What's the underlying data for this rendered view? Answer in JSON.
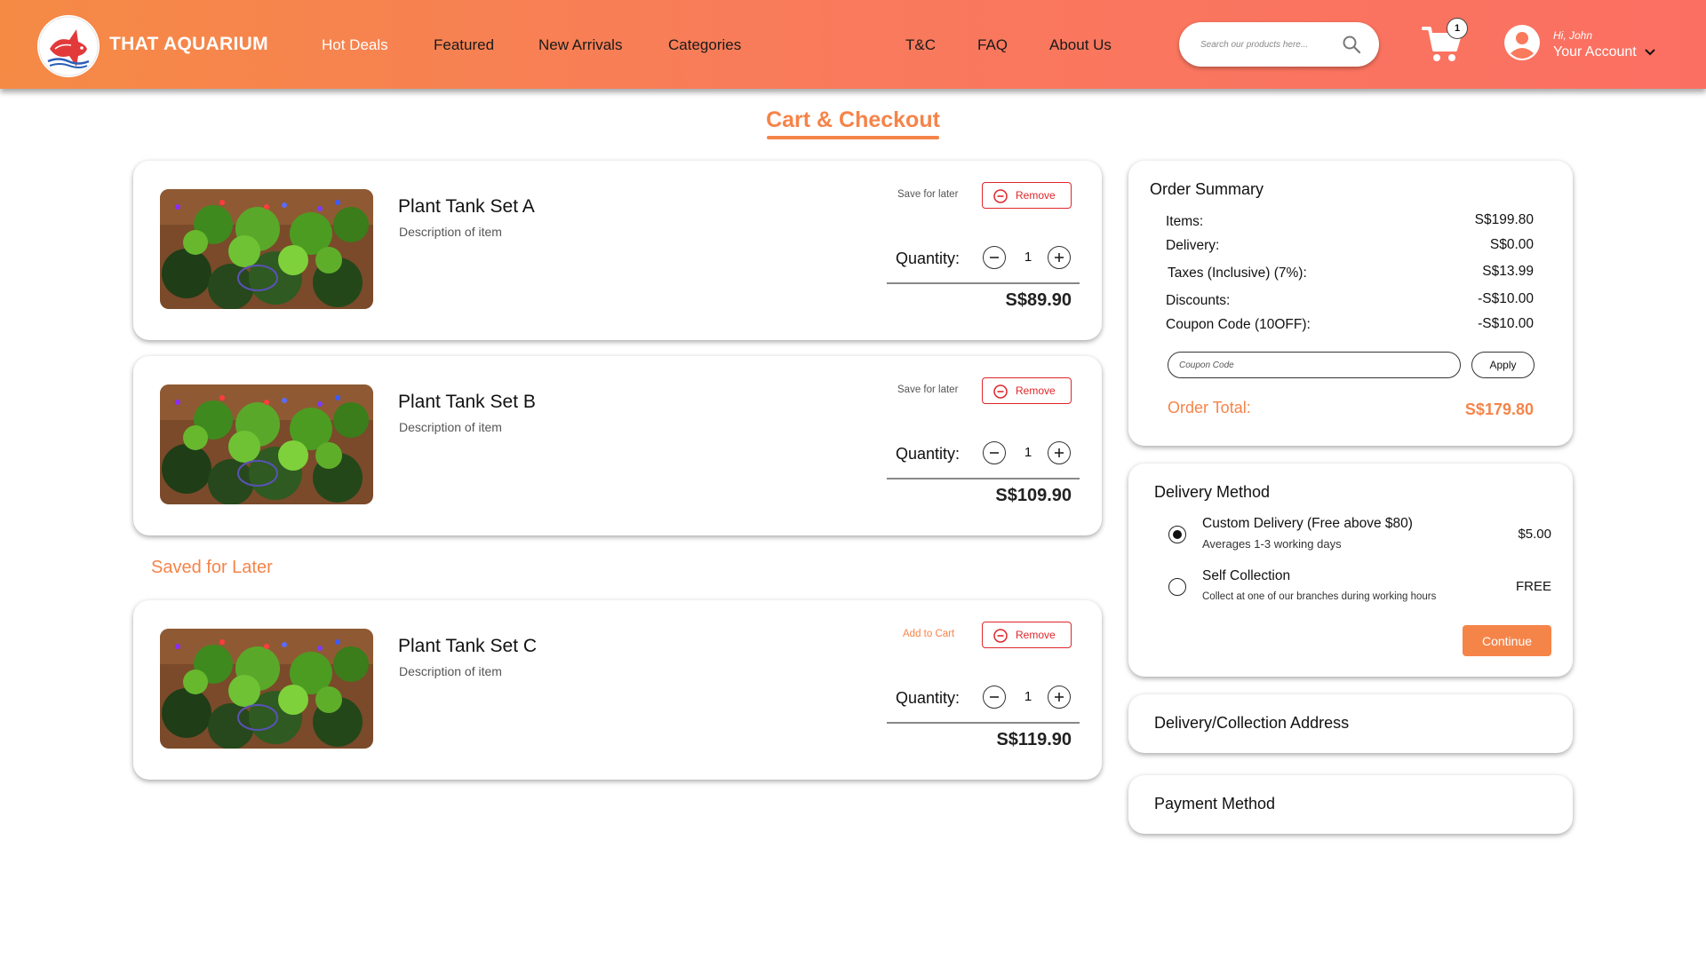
{
  "header": {
    "brand": "THAT AQUARIUM",
    "nav_left": [
      "Hot Deals",
      "Featured",
      "New Arrivals",
      "Categories"
    ],
    "nav_right": [
      "T&C",
      "FAQ",
      "About Us"
    ],
    "active_nav": "Hot Deals",
    "search_placeholder": "Search our products here...",
    "cart_count": "1",
    "greeting": "Hi, John",
    "account_label": "Your Account"
  },
  "page": {
    "title": "Cart & Checkout"
  },
  "cart_items": [
    {
      "name": "Plant Tank Set A",
      "description": "Description of item",
      "action_label": "Save for later",
      "remove_label": "Remove",
      "quantity_label": "Quantity:",
      "quantity": "1",
      "price": "S$89.90"
    },
    {
      "name": "Plant Tank Set B",
      "description": "Description of item",
      "action_label": "Save for later",
      "remove_label": "Remove",
      "quantity_label": "Quantity:",
      "quantity": "1",
      "price": "S$109.90"
    }
  ],
  "saved_for_later": {
    "heading": "Saved for Later",
    "items": [
      {
        "name": "Plant Tank Set C",
        "description": "Description of item",
        "action_label": "Add to Cart",
        "remove_label": "Remove",
        "quantity_label": "Quantity:",
        "quantity": "1",
        "price": "S$119.90"
      }
    ]
  },
  "order_summary": {
    "title": "Order Summary",
    "lines": [
      {
        "label": "Items:",
        "value": "S$199.80"
      },
      {
        "label": "Delivery:",
        "value": "S$0.00"
      },
      {
        "label": "Taxes (Inclusive) (7%):",
        "value": "S$13.99"
      },
      {
        "label": "Discounts:",
        "value": "-S$10.00"
      },
      {
        "label": "Coupon Code (10OFF):",
        "value": "-S$10.00"
      }
    ],
    "coupon_placeholder": "Coupon Code",
    "apply_label": "Apply",
    "total_label": "Order Total:",
    "total_value": "S$179.80"
  },
  "delivery_method": {
    "title": "Delivery Method",
    "options": [
      {
        "name": "Custom Delivery (Free above $80)",
        "sub": "Averages 1-3 working days",
        "price": "$5.00",
        "selected": true
      },
      {
        "name": "Self Collection",
        "sub": "Collect at one of our branches during working hours",
        "price": "FREE",
        "selected": false
      }
    ],
    "continue_label": "Continue"
  },
  "sections": {
    "address_title": "Delivery/Collection Address",
    "payment_title": "Payment Method"
  },
  "colors": {
    "accent": "#f58449",
    "remove": "#e0262a",
    "header_start": "#f58a45",
    "header_end": "#fb6f62"
  },
  "icons": [
    "logo-fish",
    "search-icon",
    "cart-icon",
    "account-icon",
    "chevron-down-icon",
    "minus-circle-icon",
    "minus-icon",
    "plus-icon"
  ]
}
